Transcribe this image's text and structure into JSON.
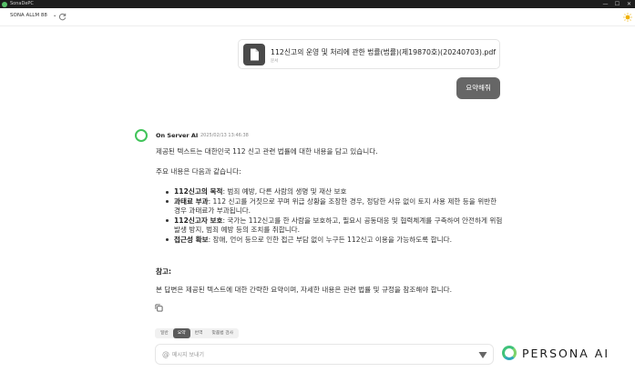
{
  "window": {
    "title": "SonaDePC",
    "controls": [
      "—",
      "☐",
      "✕"
    ]
  },
  "topbar": {
    "model": "SONA ALLM 88",
    "model_chevron": "⌄"
  },
  "attachment": {
    "name": "112신고의 운영 및 처리에 관한 법률(법률)(제19870호)(20240703).pdf",
    "type_label": "문서"
  },
  "user_message": {
    "text": "요약해줘"
  },
  "assistant": {
    "name": "On Server AI",
    "timestamp": "2025/02/13 13:46:38",
    "intro": "제공된 텍스트는 대한민국 112 신고 관련 법률에 대한 내용을 담고 있습니다.",
    "lead": "주요 내용은 다음과 같습니다:",
    "bullets": [
      {
        "bold": "112신고의 목적",
        "text": ": 범죄 예방, 다른 사람의 생명 및 재산 보호"
      },
      {
        "bold": "과태료 부과",
        "text": ": 112 신고를 거짓으로 꾸며 위급 상황을 조장한 경우, 정당한 사유 없이 토지 사용 제한 등을 위반한 경우 과태료가 부과됩니다."
      },
      {
        "bold": "112신고자 보호",
        "text": ": 국가는 112신고를 한 사람을 보호하고, 필요시 공동대응 및 협력체계를 구축하여 안전하게 위험 발생 방지, 범죄 예방 등의 조치를 취합니다."
      },
      {
        "bold": "접근성 확보",
        "text": ": 장애, 언어 등으로 인한 접근 부담 없이 누구든 112신고 이용을 가능하도록 합니다."
      }
    ],
    "ref_heading": "참고:",
    "closing": "본 답변은 제공된 텍스트에 대한 간략한 요약이며, 자세한 내용은 관련 법률 및 규정을 참조해야 합니다."
  },
  "mode_tabs": [
    {
      "label": "일반",
      "active": false
    },
    {
      "label": "요약",
      "active": true
    },
    {
      "label": "번역",
      "active": false
    },
    {
      "label": "맞춤법 검사",
      "active": false
    }
  ],
  "composer": {
    "placeholder": "메시지 보내기",
    "at_symbol": "@"
  },
  "brand": {
    "text": "PERSONA AI"
  },
  "colors": {
    "accent_green": "#41c45a",
    "bubble": "#666666",
    "titlebar": "#1e1e1e"
  }
}
